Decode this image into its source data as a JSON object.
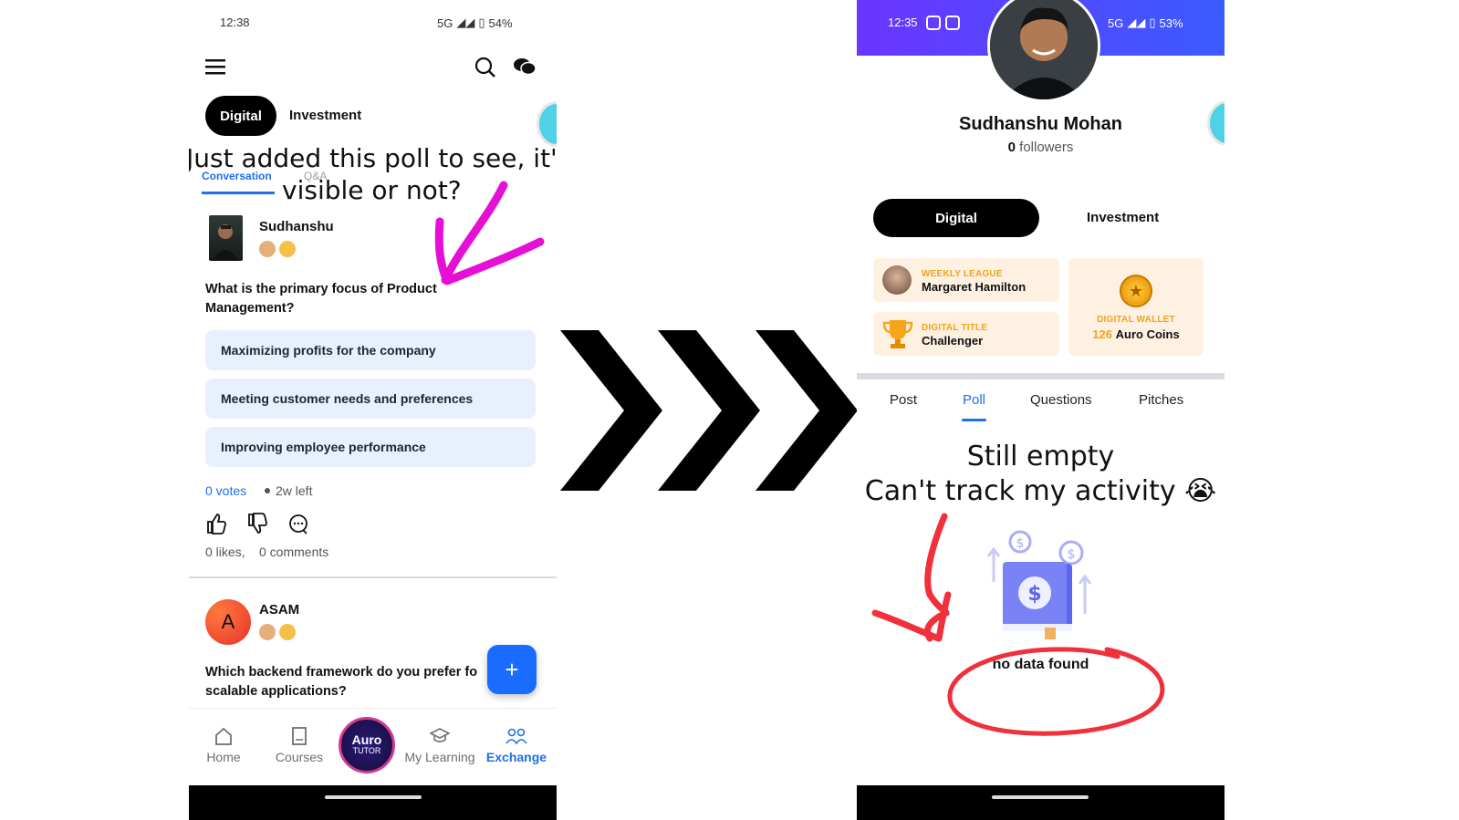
{
  "left": {
    "status": {
      "time": "12:38",
      "network": "5G",
      "battery": "54%"
    },
    "tabs": {
      "active": "Digital",
      "inactive": "Investment"
    },
    "overlay_text_line1": "Just added this poll to see, it's",
    "overlay_text_line2": "visible or not?",
    "subtabs": {
      "active": "Conversation",
      "inactive": "Q&A"
    },
    "post1": {
      "author": "Sudhanshu",
      "question": "What is the primary focus of Product Management?",
      "options": [
        "Maximizing profits for the company",
        "Meeting customer needs and preferences",
        "Improving employee performance"
      ],
      "votes": "0 votes",
      "time_left": "2w left",
      "likes": "0 likes,",
      "comments": "0 comments"
    },
    "post2": {
      "avatar_letter": "A",
      "author": "ASAM",
      "question": "Which backend framework do you prefer fo scalable applications?"
    },
    "fab_label": "+",
    "bottom_nav": [
      {
        "label": "Home",
        "icon": "home-icon"
      },
      {
        "label": "Courses",
        "icon": "book-icon"
      },
      {
        "label": "My Learning",
        "icon": "graduation-cap-icon"
      },
      {
        "label": "Exchange",
        "icon": "exchange-icon"
      }
    ],
    "center_logo": {
      "line1": "Auro",
      "line2": "TUTOR"
    },
    "colors": {
      "accent": "#1f6feb",
      "fab": "#1a6cff",
      "option_bg": "#e8f0fd",
      "annotation": "#e60fd6"
    }
  },
  "right": {
    "status": {
      "time": "12:35",
      "network": "5G",
      "battery": "53%"
    },
    "profile": {
      "name": "Sudhanshu Mohan",
      "followers_count": "0",
      "followers_label": "followers"
    },
    "tabs": {
      "active": "Digital",
      "inactive": "Investment"
    },
    "cards": {
      "weekly_league": {
        "label": "WEEKLY LEAGUE",
        "value": "Margaret Hamilton"
      },
      "digital_title": {
        "label": "DIGITAL TITLE",
        "value": "Challenger"
      },
      "digital_wallet": {
        "label": "DIGITAL WALLET",
        "amount": "126",
        "unit": "Auro Coins"
      }
    },
    "profile_tabs": [
      "Post",
      "Poll",
      "Questions",
      "Pitches"
    ],
    "active_profile_tab": "Poll",
    "overlay_text_line1": "Still empty",
    "overlay_text_line2": "Can't track my activity 😭",
    "empty_state": "no data found",
    "colors": {
      "header_gradient_start": "#6a35ff",
      "header_gradient_end": "#3b5bff",
      "annotation": "#f0303a",
      "card_bg": "#fff1e1"
    }
  }
}
